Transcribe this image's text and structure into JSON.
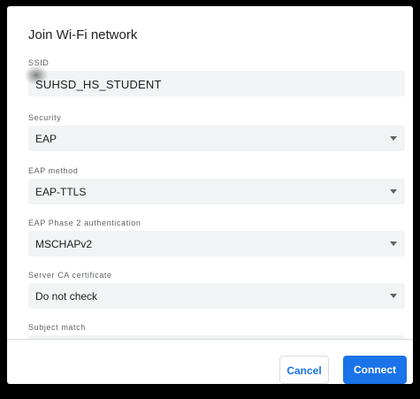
{
  "dialog": {
    "title": "Join Wi-Fi network",
    "cancel_label": "Cancel",
    "connect_label": "Connect"
  },
  "fields": {
    "ssid": {
      "label": "SSID",
      "value": "SUHSD_HS_STUDENT"
    },
    "security": {
      "label": "Security",
      "value": "EAP"
    },
    "eap_method": {
      "label": "EAP method",
      "value": "EAP-TTLS"
    },
    "phase2": {
      "label": "EAP Phase 2 authentication",
      "value": "MSCHAPv2"
    },
    "server_ca": {
      "label": "Server CA certificate",
      "value": "Do not check"
    },
    "subject_match": {
      "label": "Subject match",
      "value": ""
    }
  },
  "colors": {
    "accent": "#1a73e8",
    "field_bg": "#f1f3f4",
    "label": "#5f6368"
  }
}
